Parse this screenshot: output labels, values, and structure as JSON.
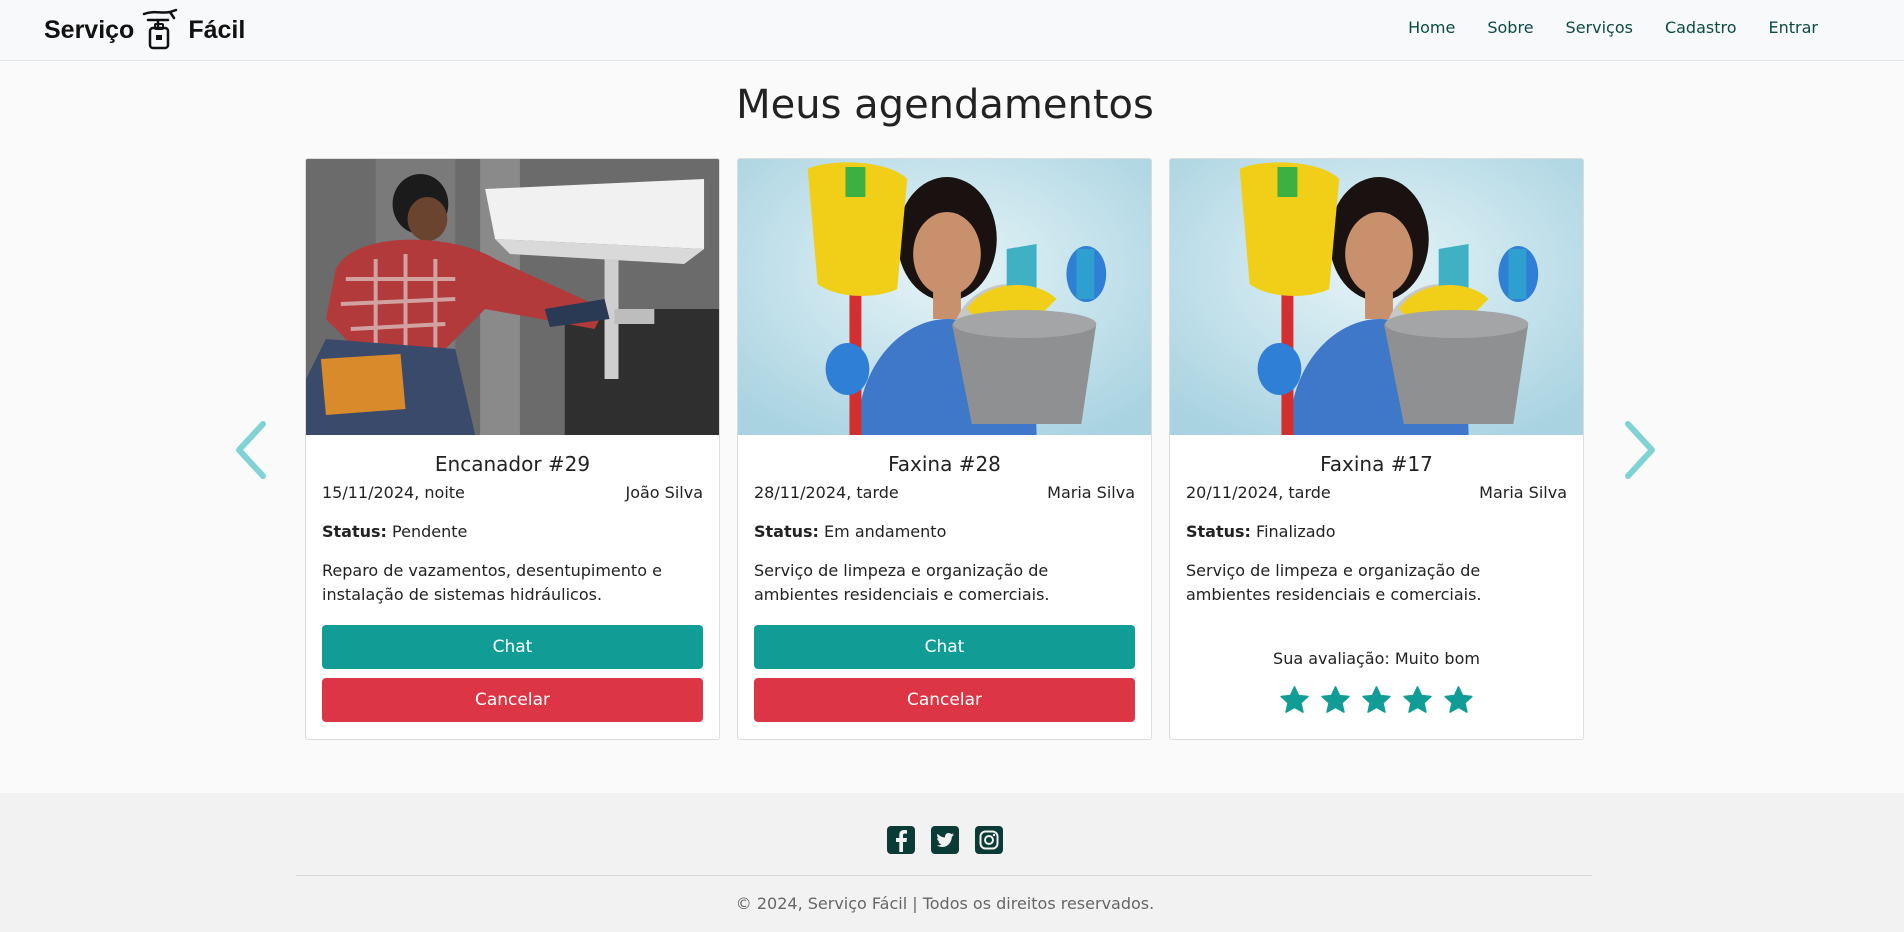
{
  "brand": {
    "name_left": "Serviço",
    "name_right": "Fácil"
  },
  "nav": {
    "items": [
      {
        "label": "Home"
      },
      {
        "label": "Sobre"
      },
      {
        "label": "Serviços"
      },
      {
        "label": "Cadastro"
      },
      {
        "label": "Entrar"
      }
    ]
  },
  "page": {
    "title": "Meus agendamentos"
  },
  "cards": [
    {
      "image_icon": "plumber-photo",
      "title": "Encanador #29",
      "date": "15/11/2024, noite",
      "provider": "João Silva",
      "status_label": "Status:",
      "status_value": "Pendente",
      "description": "Reparo de vazamentos, desentupimento e instalação de sistemas hidráulicos.",
      "chat_label": "Chat",
      "cancel_label": "Cancelar"
    },
    {
      "image_icon": "cleaner-photo",
      "title": "Faxina #28",
      "date": "28/11/2024, tarde",
      "provider": "Maria Silva",
      "status_label": "Status:",
      "status_value": "Em andamento",
      "description": "Serviço de limpeza e organização de ambientes residenciais e comerciais.",
      "chat_label": "Chat",
      "cancel_label": "Cancelar"
    },
    {
      "image_icon": "cleaner-photo",
      "title": "Faxina #17",
      "date": "20/11/2024, tarde",
      "provider": "Maria Silva",
      "status_label": "Status:",
      "status_value": "Finalizado",
      "description": "Serviço de limpeza e organização de ambientes residenciais e comerciais.",
      "rating_label": "Sua avaliação: Muito bom",
      "rating_stars": 5,
      "rating_max": 5
    }
  ],
  "footer": {
    "social_icons": [
      "facebook-icon",
      "twitter-icon",
      "instagram-icon"
    ],
    "copyright": "© 2024, Serviço Fácil | Todos os direitos reservados."
  },
  "colors": {
    "accent": "#119d96",
    "danger": "#dc3545",
    "arrow": "#7fd3d5",
    "nav_text": "#0b4a45",
    "social": "#0b3b37"
  }
}
